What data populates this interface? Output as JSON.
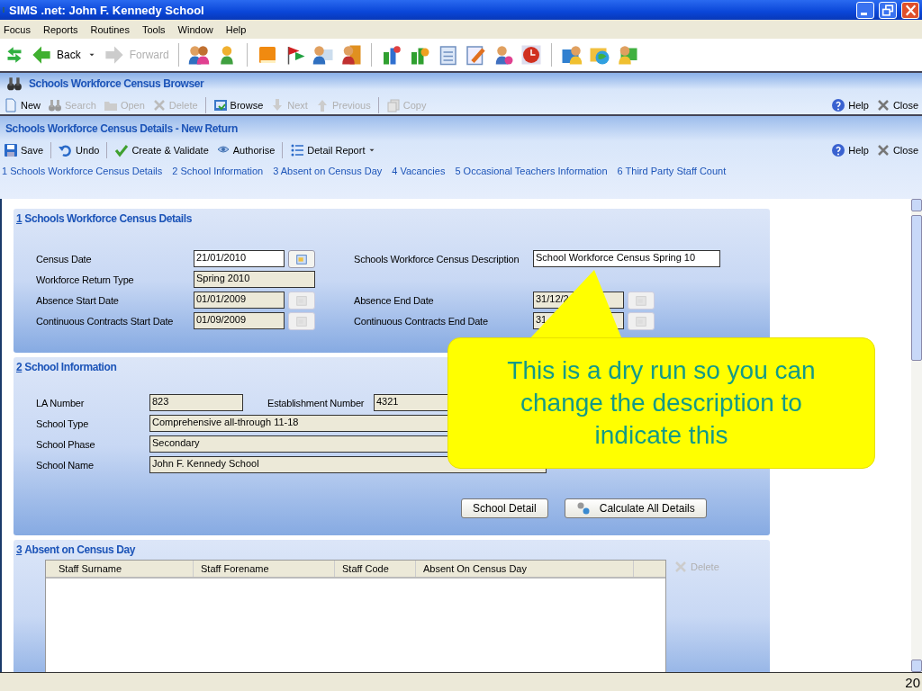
{
  "window": {
    "title": "SIMS .net: John F. Kennedy School"
  },
  "menu": [
    "Focus",
    "Reports",
    "Routines",
    "Tools",
    "Window",
    "Help"
  ],
  "toolbar": {
    "back": {
      "label": "Back",
      "disabled": false
    },
    "forward": {
      "label": "Forward",
      "disabled": true
    }
  },
  "browser": {
    "title": "Schools Workforce Census Browser",
    "help": "Help",
    "close": "Close",
    "actions": [
      {
        "label": "New",
        "disabled": false
      },
      {
        "label": "Search",
        "disabled": true
      },
      {
        "label": "Open",
        "disabled": true
      },
      {
        "label": "Delete",
        "disabled": true
      },
      {
        "label": "Browse",
        "disabled": false
      },
      {
        "label": "Next",
        "disabled": true
      },
      {
        "label": "Previous",
        "disabled": true
      },
      {
        "label": "Copy",
        "disabled": true
      }
    ]
  },
  "details": {
    "title": "Schools Workforce Census Details - New Return",
    "help": "Help",
    "close": "Close",
    "actions": [
      {
        "label": "Save"
      },
      {
        "label": "Undo"
      },
      {
        "label": "Create & Validate"
      },
      {
        "label": "Authorise"
      },
      {
        "label": "Detail Report"
      }
    ],
    "links": [
      "1 Schools Workforce Census Details",
      "2 School Information",
      "3 Absent on Census Day",
      "4 Vacancies",
      "5 Occasional Teachers Information",
      "6 Third Party Staff Count"
    ]
  },
  "section_1": {
    "number": "1",
    "title": "Schools Workforce Census Details",
    "rows": [
      {
        "left": {
          "label": "Census Date",
          "value": "21/01/2010",
          "editable": true,
          "picker": true
        },
        "right": {
          "label": "Schools Workforce Census Description",
          "value": "School Workforce Census Spring 10",
          "editable": true,
          "picker": false
        }
      },
      {
        "left": {
          "label": "Workforce Return Type",
          "value": "Spring 2010",
          "editable": false,
          "picker": false
        }
      },
      {
        "left": {
          "label": "Absence Start Date",
          "value": "01/01/2009",
          "editable": false,
          "picker": true
        },
        "right": {
          "label": "Absence End Date",
          "value": "31/12/2",
          "editable": false,
          "picker": true
        }
      },
      {
        "left": {
          "label": "Continuous Contracts Start Date",
          "value": "01/09/2009",
          "editable": false,
          "picker": true
        },
        "right": {
          "label": "Continuous Contracts End Date",
          "value": "31",
          "editable": false,
          "picker": true
        }
      }
    ]
  },
  "section_2": {
    "number": "2",
    "title": "School Information",
    "la_number": {
      "label": "LA Number",
      "value": "823"
    },
    "establishment_number": {
      "label": "Establishment Number",
      "value": "4321"
    },
    "fields": [
      {
        "label": "School Type",
        "value": "Comprehensive all-through 11-18"
      },
      {
        "label": "School Phase",
        "value": "Secondary"
      },
      {
        "label": "School Name",
        "value": "John F. Kennedy School"
      }
    ],
    "buttons": [
      "School Detail",
      "Calculate All Details"
    ]
  },
  "section_3": {
    "number": "3",
    "title": "Absent on Census Day",
    "columns": [
      "Staff Surname",
      "Staff Forename",
      "Staff Code",
      "Absent On Census Day"
    ],
    "delete": {
      "label": "Delete",
      "disabled": true
    }
  },
  "callout": {
    "text": "This is a dry run so you can change the description to indicate this"
  },
  "status_bar": {
    "page": "20"
  }
}
